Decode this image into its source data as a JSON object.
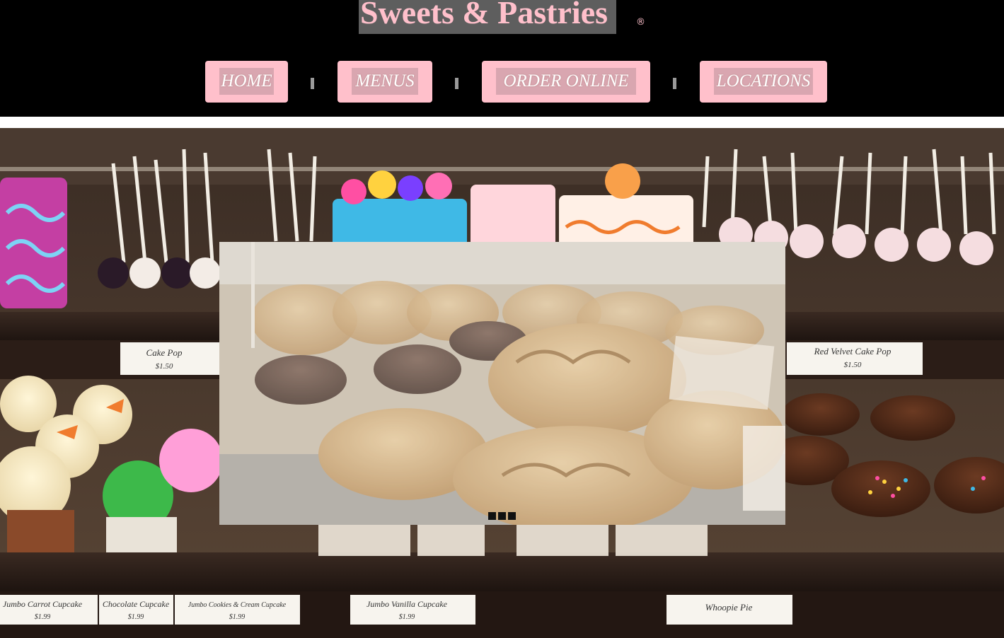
{
  "header": {
    "brand": "Sweets & Pastries",
    "registered_mark": "®"
  },
  "nav": {
    "items": [
      {
        "label": "HOME"
      },
      {
        "label": "MENUS"
      },
      {
        "label": "ORDER ONLINE"
      },
      {
        "label": "LOCATIONS"
      }
    ],
    "separator": "|"
  },
  "hero": {
    "price_cards": [
      {
        "name": "Cake Pop",
        "price": "$1.50"
      },
      {
        "name": "Red Velvet Cake Pop",
        "price": "$1.50"
      },
      {
        "name": "Jumbo Carrot Cupcake",
        "price": "$1.99"
      },
      {
        "name": "Chocolate Cupcake",
        "price": "$1.99"
      },
      {
        "name": "Jumbo Cookies & Cream Cupcake",
        "price": "$1.99"
      },
      {
        "name": "Jumbo Vanilla Cupcake",
        "price": "$1.99"
      },
      {
        "name": "Whoopie Pie",
        "price": ""
      }
    ]
  },
  "slideshow": {
    "slide_count": 3,
    "active_index": 0
  },
  "colors": {
    "background": "#000000",
    "accent_pink": "#ffc0cb",
    "brand_bg": "#5e5e5e",
    "divider": "#ffffff"
  }
}
